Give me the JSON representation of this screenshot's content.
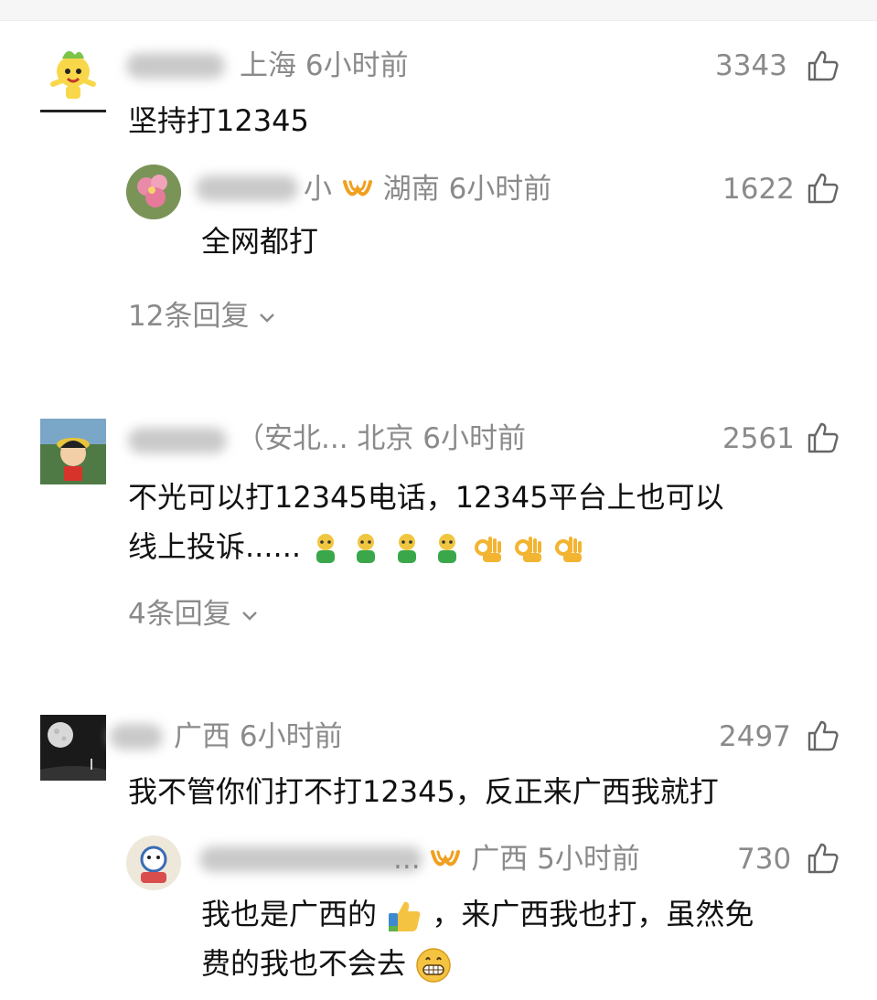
{
  "comments": [
    {
      "location": "上海",
      "time": "6小时前",
      "likes": "3343",
      "text": "坚持打12345",
      "reply": {
        "name_tail": "小",
        "location": "湖南",
        "time": "6小时前",
        "likes": "1622",
        "text": "全网都打"
      },
      "more_replies": "12条回复"
    },
    {
      "name_tail": "（安北...",
      "location": "北京",
      "time": "6小时前",
      "likes": "2561",
      "text_line1": "不光可以打12345电话，12345平台上也可以",
      "text_line2": "线上投诉......",
      "more_replies": "4条回复"
    },
    {
      "location": "广西",
      "time": "6小时前",
      "likes": "2497",
      "text": "我不管你们打不打12345，反正来广西我就打",
      "reply": {
        "name_tail": "...",
        "location": "广西",
        "time": "5小时前",
        "likes": "730",
        "text_line1a": "我也是广西的",
        "text_line1b": "，来广西我也打，虽然免",
        "text_line2": "费的我也不会去"
      }
    }
  ],
  "icons": {
    "like": "thumbs-up-outline-icon",
    "vip": "vip-badge-icon",
    "expand": "chevron-down-icon"
  },
  "colors": {
    "meta": "#8a8a8a",
    "text": "#111111",
    "vip": "#f0a020"
  }
}
